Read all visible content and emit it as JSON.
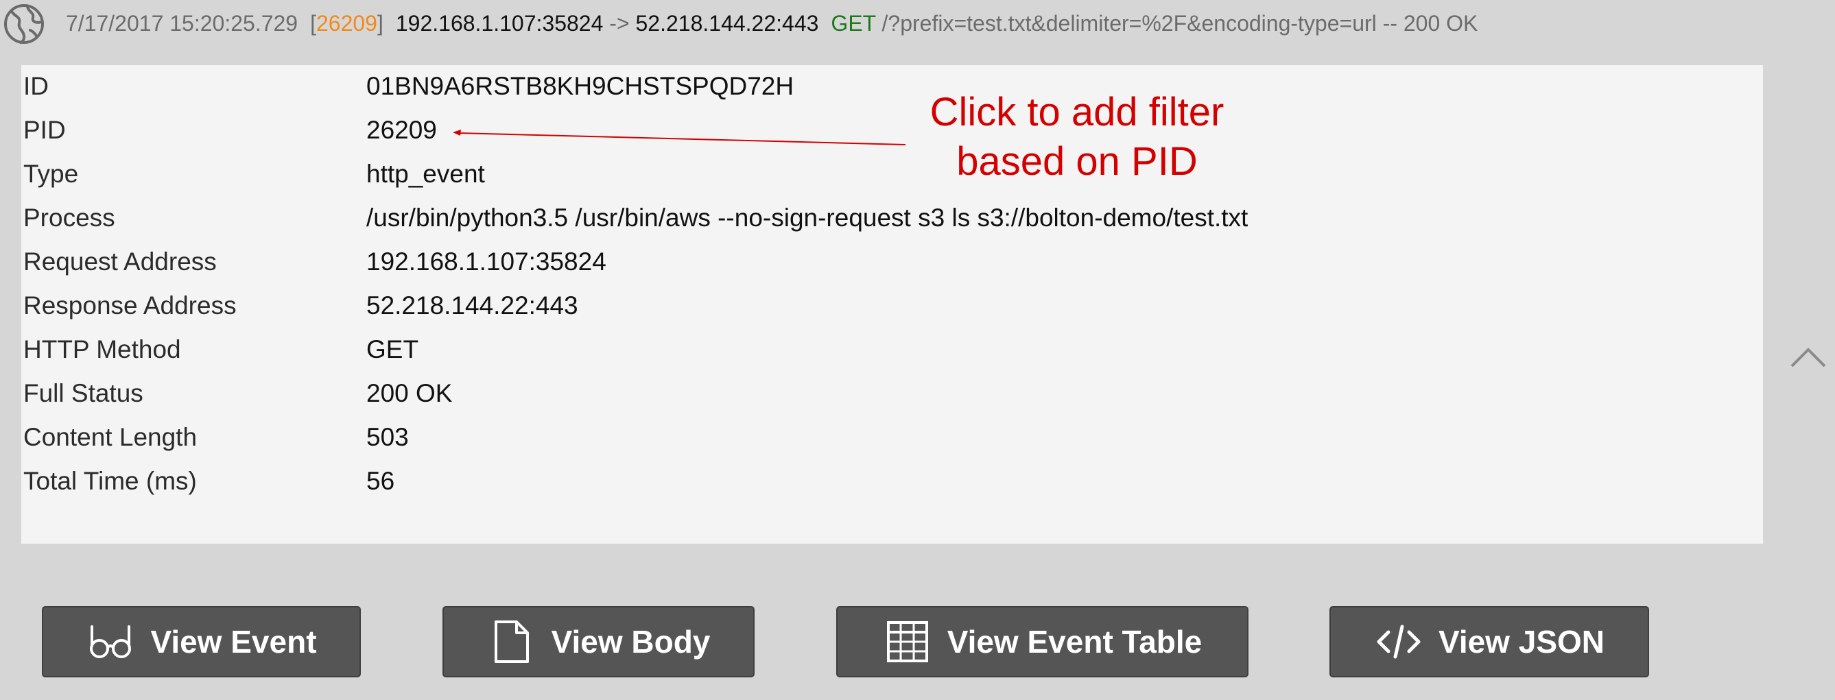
{
  "header": {
    "timestamp": "7/17/2017 15:20:25.729",
    "bracket_open": "[",
    "pid": "26209",
    "bracket_close": "]",
    "source": "192.168.1.107:35824",
    "arrow": "->",
    "destination": "52.218.144.22:443",
    "method": "GET",
    "path_and_status": "/?prefix=test.txt&delimiter=%2F&encoding-type=url -- 200 OK",
    "icon": "globe-icon",
    "colors": {
      "pid": "#f08a1c",
      "method": "#1c7a1c",
      "muted": "#6b6b6b"
    }
  },
  "details": {
    "rows": [
      {
        "key": "ID",
        "value": "01BN9A6RSTB8KH9CHSTSPQD72H"
      },
      {
        "key": "PID",
        "value": "26209"
      },
      {
        "key": "Type",
        "value": "http_event"
      },
      {
        "key": "Process",
        "value": "/usr/bin/python3.5 /usr/bin/aws --no-sign-request s3 ls s3://bolton-demo/test.txt"
      },
      {
        "key": "Request Address",
        "value": "192.168.1.107:35824"
      },
      {
        "key": "Response Address",
        "value": "52.218.144.22:443"
      },
      {
        "key": "HTTP Method",
        "value": "GET"
      },
      {
        "key": "Full Status",
        "value": "200 OK"
      },
      {
        "key": "Content Length",
        "value": "503"
      },
      {
        "key": "Total Time (ms)",
        "value": "56"
      }
    ]
  },
  "annotation": {
    "line1": "Click to add filter",
    "line2": "based on PID",
    "color": "#d40000"
  },
  "collapse": {
    "icon": "chevron-up-icon"
  },
  "buttons": {
    "view_event": {
      "label": "View Event",
      "icon": "glasses-icon"
    },
    "view_body": {
      "label": "View Body",
      "icon": "file-icon"
    },
    "view_event_table": {
      "label": "View Event Table",
      "icon": "table-icon"
    },
    "view_json": {
      "label": "View JSON",
      "icon": "code-icon"
    }
  }
}
